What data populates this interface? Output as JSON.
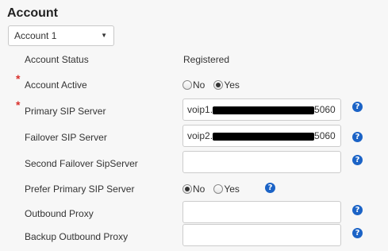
{
  "section": {
    "title": "Account"
  },
  "account_select": {
    "selected": "Account 1",
    "caret": "▼"
  },
  "rows": {
    "status": {
      "label": "Account Status",
      "value": "Registered"
    },
    "active": {
      "label": "Account Active",
      "required": "*",
      "options": [
        "No",
        "Yes"
      ],
      "selected": "Yes"
    },
    "primary_sip": {
      "label": "Primary SIP Server",
      "required": "*",
      "value_prefix": "voip1.",
      "value_suffix": "5060",
      "redacted": true
    },
    "failover_sip": {
      "label": "Failover SIP Server",
      "value_prefix": "voip2.",
      "value_suffix": "5060",
      "redacted": true
    },
    "second_failover": {
      "label": "Second Failover SipServer",
      "value": ""
    },
    "prefer_primary": {
      "label": "Prefer Primary SIP Server",
      "options": [
        "No",
        "Yes"
      ],
      "selected": "No"
    },
    "outbound_proxy": {
      "label": "Outbound Proxy",
      "value": ""
    },
    "backup_outbound_proxy": {
      "label": "Backup Outbound Proxy",
      "value": ""
    }
  },
  "help": {
    "glyph": "?"
  },
  "colors": {
    "accent": "#1b63c6",
    "required": "#d9302c"
  },
  "icons": {
    "help": "question-circle-icon",
    "caret": "caret-down-icon",
    "redaction": "redaction-bar"
  }
}
